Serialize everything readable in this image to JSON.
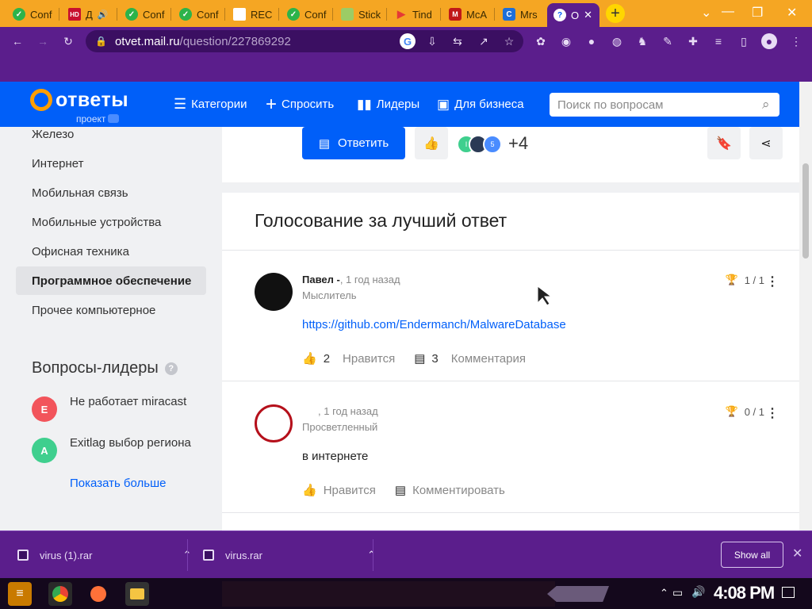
{
  "browser": {
    "tabs": [
      {
        "label": "Conf",
        "favicon": "check-green"
      },
      {
        "label": "Д",
        "favicon": "hd-red"
      },
      {
        "label": "Conf",
        "favicon": "check-green"
      },
      {
        "label": "Conf",
        "favicon": "check-green"
      },
      {
        "label": "REC",
        "favicon": "blank-white"
      },
      {
        "label": "Conf",
        "favicon": "check-green"
      },
      {
        "label": "Stick",
        "favicon": "sticker"
      },
      {
        "label": "Tind",
        "favicon": "play"
      },
      {
        "label": "McA",
        "favicon": "mcafee"
      },
      {
        "label": "Mrs",
        "favicon": "c-blue"
      },
      {
        "label": "О",
        "favicon": "question-blue"
      }
    ],
    "url_host": "otvet.mail.ru",
    "url_path": "/question/227869292",
    "accent_color": "#5b1e8c",
    "tab_strip_color": "#f5a623"
  },
  "site": {
    "logo_word": "ответы",
    "logo_sub": "проект",
    "nav": {
      "categories": "Категории",
      "ask": "Спросить",
      "leaders": "Лидеры",
      "business": "Для бизнеса"
    },
    "search_placeholder": "Поиск по вопросам",
    "brand_color": "#005ff9"
  },
  "sidebar": {
    "items": [
      {
        "label": "Железо",
        "active": false
      },
      {
        "label": "Интернет",
        "active": false
      },
      {
        "label": "Мобильная связь",
        "active": false
      },
      {
        "label": "Мобильные устройства",
        "active": false
      },
      {
        "label": "Офисная техника",
        "active": false
      },
      {
        "label": "Программное обеспечение",
        "active": true
      },
      {
        "label": "Прочее компьютерное",
        "active": false
      }
    ],
    "leaders_title": "Вопросы-лидеры",
    "leaders": [
      {
        "initial": "E",
        "text": "Не работает miracast",
        "color": "#f2545b"
      },
      {
        "initial": "A",
        "text": "Exitlag выбор региона",
        "color": "#3fcf8e"
      }
    ],
    "show_more": "Показать больше"
  },
  "question_bar": {
    "reply_label": "Ответить",
    "avatar_badge_1": "I",
    "avatar_badge_2": "5",
    "extra_count": "+4"
  },
  "voting": {
    "title": "Голосование за лучший ответ",
    "answers": [
      {
        "name": "Павел -",
        "time": ", 1 год назад",
        "rank": "Мыслитель",
        "body": "https://github.com/Endermanch/MalwareDatabase",
        "is_link": true,
        "likes": "2",
        "likes_label": "Нравится",
        "comments": "3",
        "comments_label": "Комментария",
        "score": "1 / 1"
      },
      {
        "name": "",
        "time": ", 1 год назад",
        "rank": "Просветленный",
        "body": "в интернете",
        "is_link": false,
        "likes_label": "Нравится",
        "comments_label": "Комментировать",
        "score": "0 / 1"
      }
    ]
  },
  "downloads": {
    "files": [
      "virus (1).rar",
      "virus.rar"
    ],
    "show_all": "Show all"
  },
  "taskbar": {
    "clock": "4:08 PM"
  }
}
